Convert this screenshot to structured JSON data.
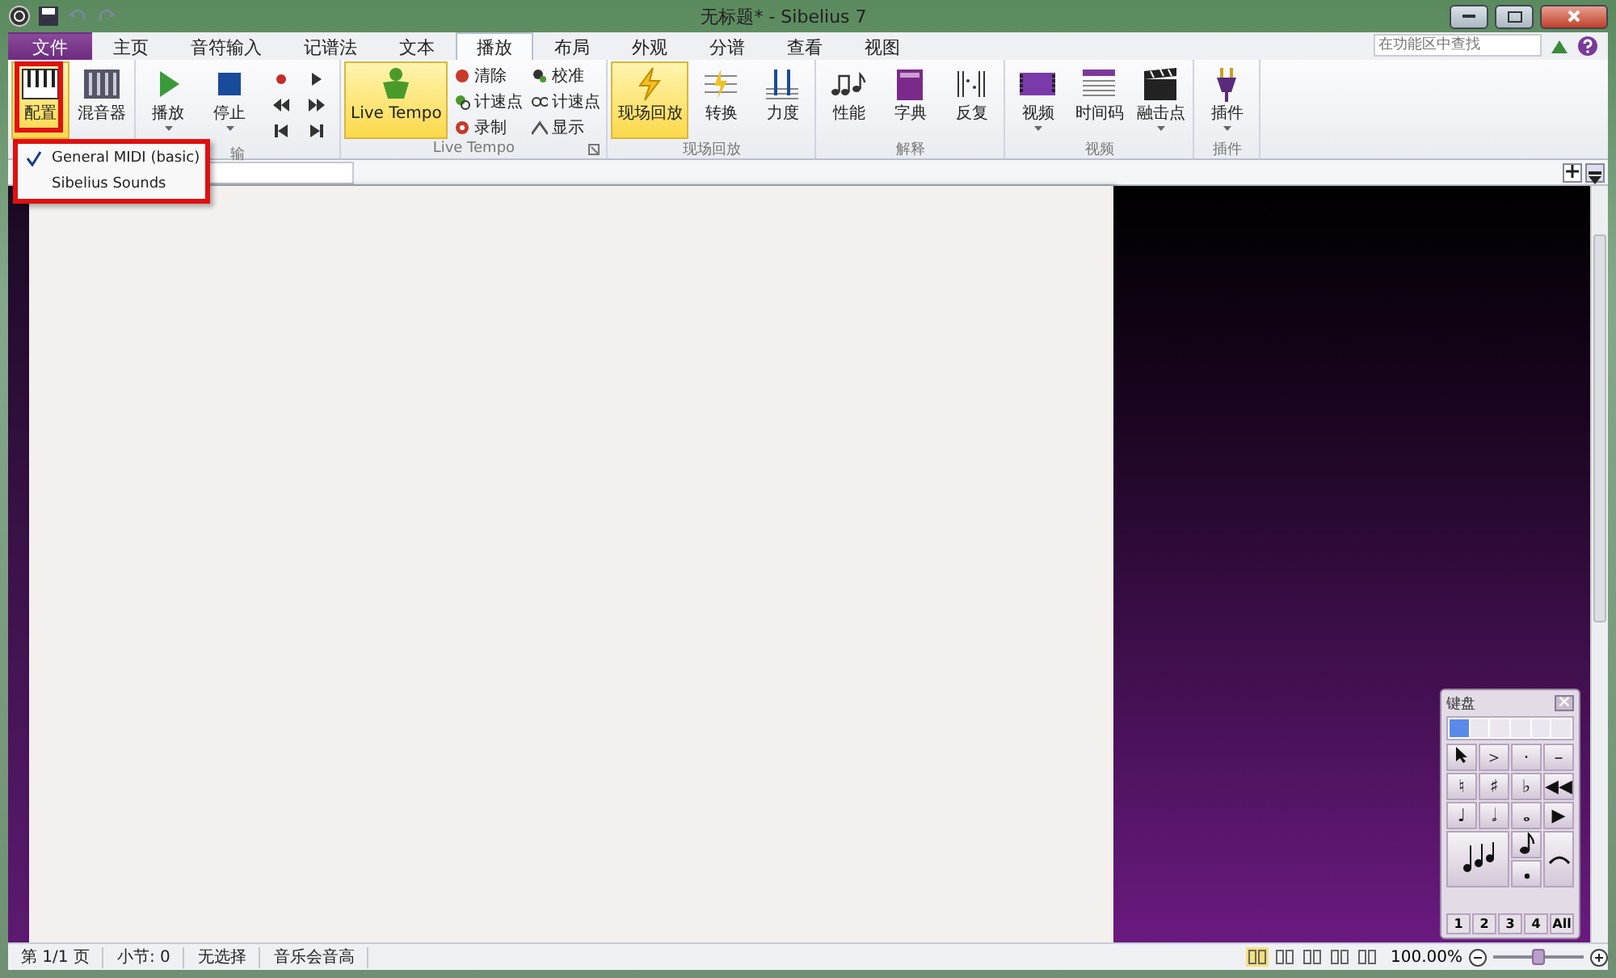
{
  "window": {
    "title": "无标题* - Sibelius 7"
  },
  "tabs": [
    {
      "label": "文件",
      "kind": "file",
      "selected": false
    },
    {
      "label": "主页",
      "kind": "tab",
      "selected": false
    },
    {
      "label": "音符输入",
      "kind": "tab",
      "selected": false
    },
    {
      "label": "记谱法",
      "kind": "tab",
      "selected": false
    },
    {
      "label": "文本",
      "kind": "tab",
      "selected": false
    },
    {
      "label": "播放",
      "kind": "tab",
      "selected": true
    },
    {
      "label": "布局",
      "kind": "tab",
      "selected": false
    },
    {
      "label": "外观",
      "kind": "tab",
      "selected": false
    },
    {
      "label": "分谱",
      "kind": "tab",
      "selected": false
    },
    {
      "label": "查看",
      "kind": "tab",
      "selected": false
    },
    {
      "label": "视图",
      "kind": "tab",
      "selected": false
    }
  ],
  "search": {
    "placeholder": "在功能区中查找"
  },
  "ribbon": {
    "groups": [
      {
        "items": [
          {
            "kind": "large",
            "label": "配置",
            "selected": true,
            "caret": false
          },
          {
            "kind": "large",
            "label": "混音器",
            "selected": false,
            "caret": false
          }
        ]
      },
      {
        "label": "输",
        "items": [
          {
            "kind": "large",
            "label": "播放",
            "selected": false,
            "caret": true
          },
          {
            "kind": "large",
            "label": "停止",
            "selected": false,
            "caret": true
          },
          {
            "kind": "transport"
          }
        ]
      },
      {
        "label": "Live Tempo",
        "launcher": true,
        "items": [
          {
            "kind": "large",
            "label": "Live Tempo",
            "selected": true,
            "caret": false
          },
          {
            "kind": "small",
            "labels": [
              "清除",
              "计速点",
              "录制"
            ]
          },
          {
            "kind": "small",
            "labels": [
              "校准",
              "计速点",
              "显示"
            ]
          }
        ]
      },
      {
        "label": "现场回放",
        "items": [
          {
            "kind": "large",
            "label": "现场回放",
            "selected": true,
            "caret": false
          },
          {
            "kind": "large",
            "label": "转换",
            "selected": false,
            "caret": false
          },
          {
            "kind": "large",
            "label": "力度",
            "selected": false,
            "caret": false
          }
        ]
      },
      {
        "label": "解释",
        "items": [
          {
            "kind": "large",
            "label": "性能",
            "selected": false,
            "caret": false
          },
          {
            "kind": "large",
            "label": "字典",
            "selected": false,
            "caret": false
          },
          {
            "kind": "large",
            "label": "反复",
            "selected": false,
            "caret": false
          }
        ]
      },
      {
        "label": "视频",
        "items": [
          {
            "kind": "large",
            "label": "视频",
            "selected": false,
            "caret": true
          },
          {
            "kind": "large",
            "label": "时间码",
            "selected": false,
            "caret": false
          },
          {
            "kind": "large",
            "label": "融击点",
            "selected": false,
            "caret": true
          }
        ]
      },
      {
        "label": "插件",
        "items": [
          {
            "kind": "large",
            "label": "插件",
            "selected": false,
            "caret": true
          }
        ]
      }
    ]
  },
  "menu": {
    "items": [
      {
        "label": "General MIDI (basic)",
        "checked": true
      },
      {
        "label": "Sibelius Sounds",
        "checked": false
      }
    ]
  },
  "keypad": {
    "title": "键盘",
    "layout_tabs": [
      {
        "selected": true
      },
      {
        "selected": false
      },
      {
        "selected": false
      },
      {
        "selected": false
      },
      {
        "selected": false
      },
      {
        "selected": false
      }
    ],
    "keys": [
      "＞",
      "·",
      "–",
      "♮",
      "♯",
      "♭",
      "◀◀",
      "♩",
      "𝅗𝅥",
      "𝅝",
      "▶"
    ],
    "layers": [
      {
        "label": "1",
        "selected": false
      },
      {
        "label": "2",
        "selected": false
      },
      {
        "label": "3",
        "selected": false
      },
      {
        "label": "4",
        "selected": false
      },
      {
        "label": "All",
        "selected": false
      }
    ]
  },
  "status_bar": {
    "items": [
      "第 1/1 页",
      "小节: 0",
      "无选择",
      "音乐会音高"
    ],
    "zoom": "100.00%",
    "zoom_slider": {
      "level": 0.5
    }
  }
}
